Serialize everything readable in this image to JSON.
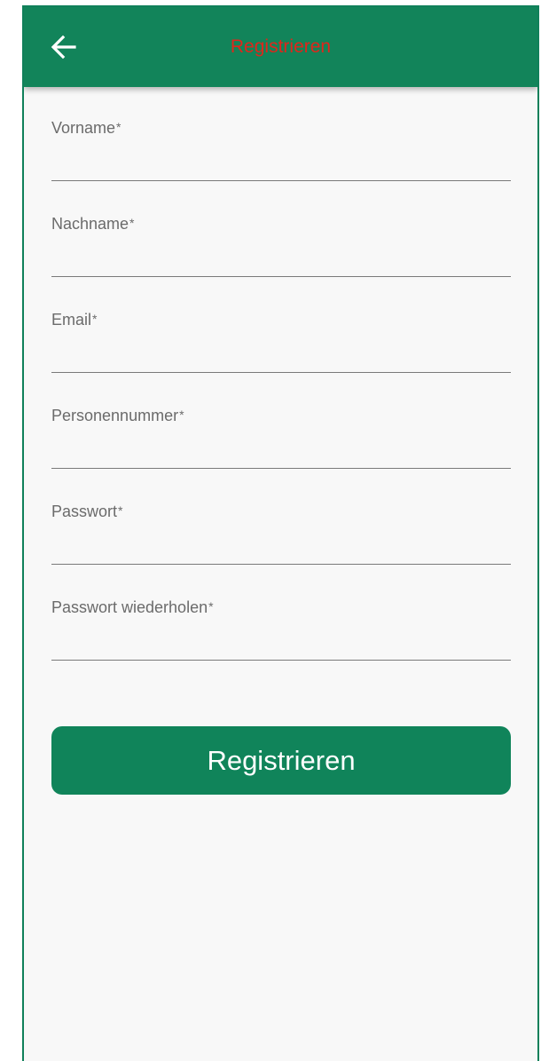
{
  "appbar": {
    "back_icon": "arrow-left-icon",
    "title": "Registrieren",
    "background_color": "#12845a",
    "title_color": "#e0261b"
  },
  "form": {
    "fields": [
      {
        "label": "Vorname",
        "required_mark": "*",
        "value": ""
      },
      {
        "label": "Nachname",
        "required_mark": "*",
        "value": ""
      },
      {
        "label": "Email",
        "required_mark": "*",
        "value": ""
      },
      {
        "label": "Personennummer",
        "required_mark": "*",
        "value": ""
      },
      {
        "label": "Passwort",
        "required_mark": "*",
        "value": ""
      },
      {
        "label": "Passwort wiederholen",
        "required_mark": "*",
        "value": ""
      }
    ],
    "submit_label": "Registrieren",
    "submit_color": "#10845a"
  }
}
